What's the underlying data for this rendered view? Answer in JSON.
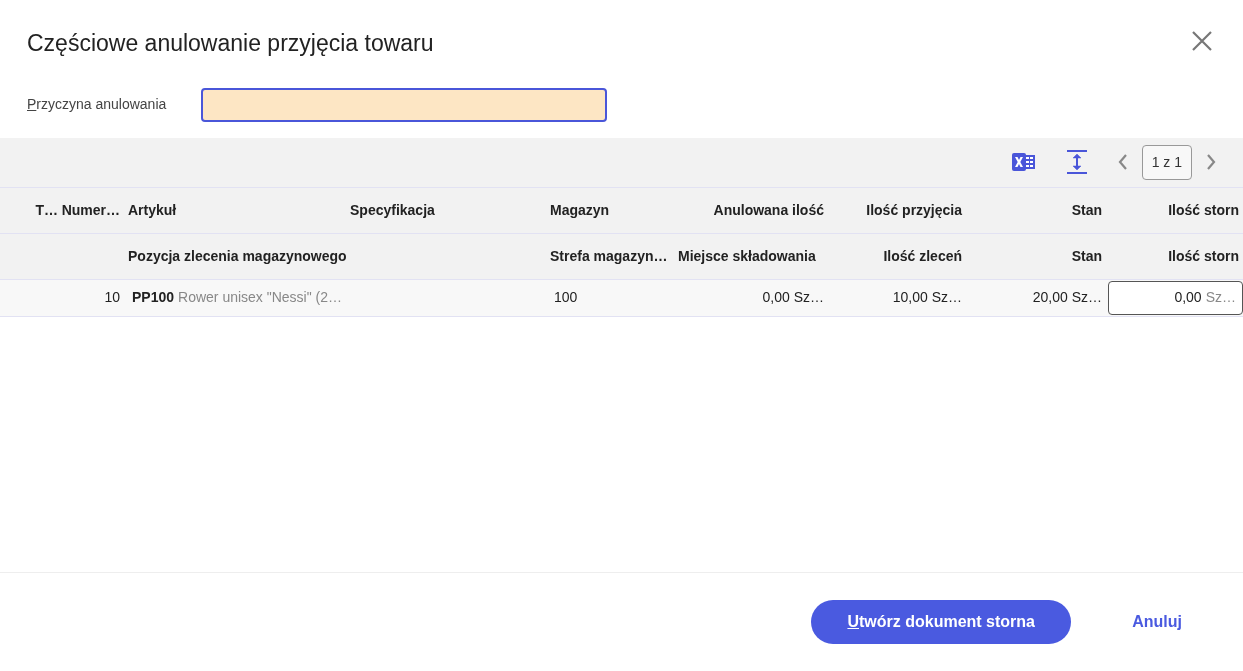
{
  "dialog": {
    "title": "Częściowe anulowanie przyjęcia towaru"
  },
  "reason_field": {
    "access_key": "P",
    "label_rest": "rzyczyna anulowania",
    "focused": true
  },
  "toolbar": {
    "page_indicator": "1 z 1"
  },
  "header_rows": [
    [
      "T…",
      "Numer…",
      "Artykuł",
      "Specyfikacja",
      "Magazyn",
      "Anulowana ilość",
      "Ilość przyjęcia",
      "Stan",
      "Ilość storn"
    ],
    [
      null,
      null,
      "Pozycja zlecenia magazynowego",
      null,
      "Strefa magazyn…",
      "Miejsce składowania",
      "Ilość zleceń",
      "Stan",
      "Ilość storn"
    ]
  ],
  "rows": [
    {
      "number": "10",
      "article_code": "PP100",
      "article_name": "Rower unisex \"Nessi\" (2…",
      "warehouse": "100",
      "cancelled_qty": "0,00 Sz…",
      "receipt_qty": "10,00 Sz…",
      "stock": "20,00 Sz…",
      "storno_qty": {
        "value": "0,00",
        "unit": "Sz…"
      }
    }
  ],
  "buttons": [
    {
      "access_key": "U",
      "label_rest": "twórz dokument storna",
      "kind": "primary"
    },
    {
      "label_rest": "Anuluj",
      "kind": "link"
    }
  ]
}
